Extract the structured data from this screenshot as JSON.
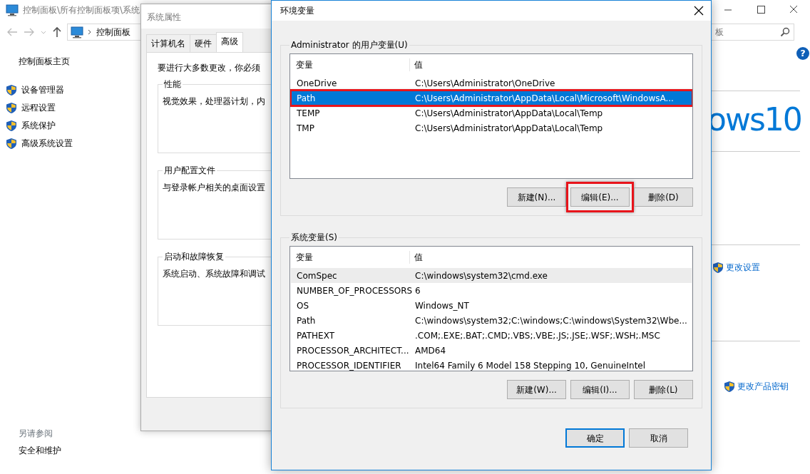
{
  "control_panel": {
    "title": "控制面板\\所有控制面板项\\系统",
    "address": "控制面板",
    "search": {
      "placeholder": "板"
    },
    "sidebar": {
      "home": "控制面板主页",
      "items": [
        "设备管理器",
        "远程设置",
        "系统保护",
        "高级系统设置"
      ]
    },
    "see_also": {
      "heading": "另请参阅",
      "links": [
        "安全和维护"
      ]
    },
    "edition_logo": "ows10",
    "help_icon": "?",
    "links": [
      "更改设置",
      "更改产品密钥"
    ]
  },
  "system_properties": {
    "title": "系统属性",
    "tabs": [
      {
        "label": "计算机名",
        "selected": false
      },
      {
        "label": "硬件",
        "selected": false
      },
      {
        "label": "高级",
        "selected": true
      }
    ],
    "note": "要进行大多数更改，你必须",
    "groups": [
      {
        "legend": "性能",
        "text": "视觉效果，处理器计划，内"
      },
      {
        "legend": "用户配置文件",
        "text": "与登录帐户相关的桌面设置"
      },
      {
        "legend": "启动和故障恢复",
        "text": "系统启动、系统故障和调试"
      }
    ]
  },
  "env_dialog": {
    "title": "环境变量",
    "user_vars": {
      "legend": "Administrator 的用户变量(U)",
      "columns": [
        "变量",
        "值"
      ],
      "rows": [
        {
          "name": "OneDrive",
          "value": "C:\\Users\\Administrator\\OneDrive",
          "selected": false,
          "hovered": false,
          "highlighted": false
        },
        {
          "name": "Path",
          "value": "C:\\Users\\Administrator\\AppData\\Local\\Microsoft\\WindowsA...",
          "selected": true,
          "hovered": false,
          "highlighted": true
        },
        {
          "name": "TEMP",
          "value": "C:\\Users\\Administrator\\AppData\\Local\\Temp",
          "selected": false,
          "hovered": false,
          "highlighted": false
        },
        {
          "name": "TMP",
          "value": "C:\\Users\\Administrator\\AppData\\Local\\Temp",
          "selected": false,
          "hovered": false,
          "highlighted": false
        }
      ],
      "buttons": [
        {
          "label": "新建(N)...",
          "highlighted": false
        },
        {
          "label": "编辑(E)...",
          "highlighted": true
        },
        {
          "label": "删除(D)",
          "highlighted": false
        }
      ]
    },
    "system_vars": {
      "legend": "系统变量(S)",
      "columns": [
        "变量",
        "值"
      ],
      "rows": [
        {
          "name": "ComSpec",
          "value": "C:\\windows\\system32\\cmd.exe",
          "selected": false,
          "hovered": true,
          "highlighted": false
        },
        {
          "name": "NUMBER_OF_PROCESSORS",
          "value": "6",
          "selected": false,
          "hovered": false,
          "highlighted": false
        },
        {
          "name": "OS",
          "value": "Windows_NT",
          "selected": false,
          "hovered": false,
          "highlighted": false
        },
        {
          "name": "Path",
          "value": "C:\\windows\\system32;C:\\windows;C:\\windows\\System32\\Wbe...",
          "selected": false,
          "hovered": false,
          "highlighted": false
        },
        {
          "name": "PATHEXT",
          "value": ".COM;.EXE;.BAT;.CMD;.VBS;.VBE;.JS;.JSE;.WSF;.WSH;.MSC",
          "selected": false,
          "hovered": false,
          "highlighted": false
        },
        {
          "name": "PROCESSOR_ARCHITECT...",
          "value": "AMD64",
          "selected": false,
          "hovered": false,
          "highlighted": false
        },
        {
          "name": "PROCESSOR_IDENTIFIER",
          "value": "Intel64 Family 6 Model 158 Stepping 10, GenuineIntel",
          "selected": false,
          "hovered": false,
          "highlighted": false
        }
      ],
      "buttons": [
        {
          "label": "新建(W)...",
          "highlighted": false
        },
        {
          "label": "编辑(I)...",
          "highlighted": false
        },
        {
          "label": "删除(L)",
          "highlighted": false
        }
      ]
    },
    "footer_buttons": [
      {
        "label": "确定",
        "default": true
      },
      {
        "label": "取消",
        "default": false
      }
    ]
  }
}
